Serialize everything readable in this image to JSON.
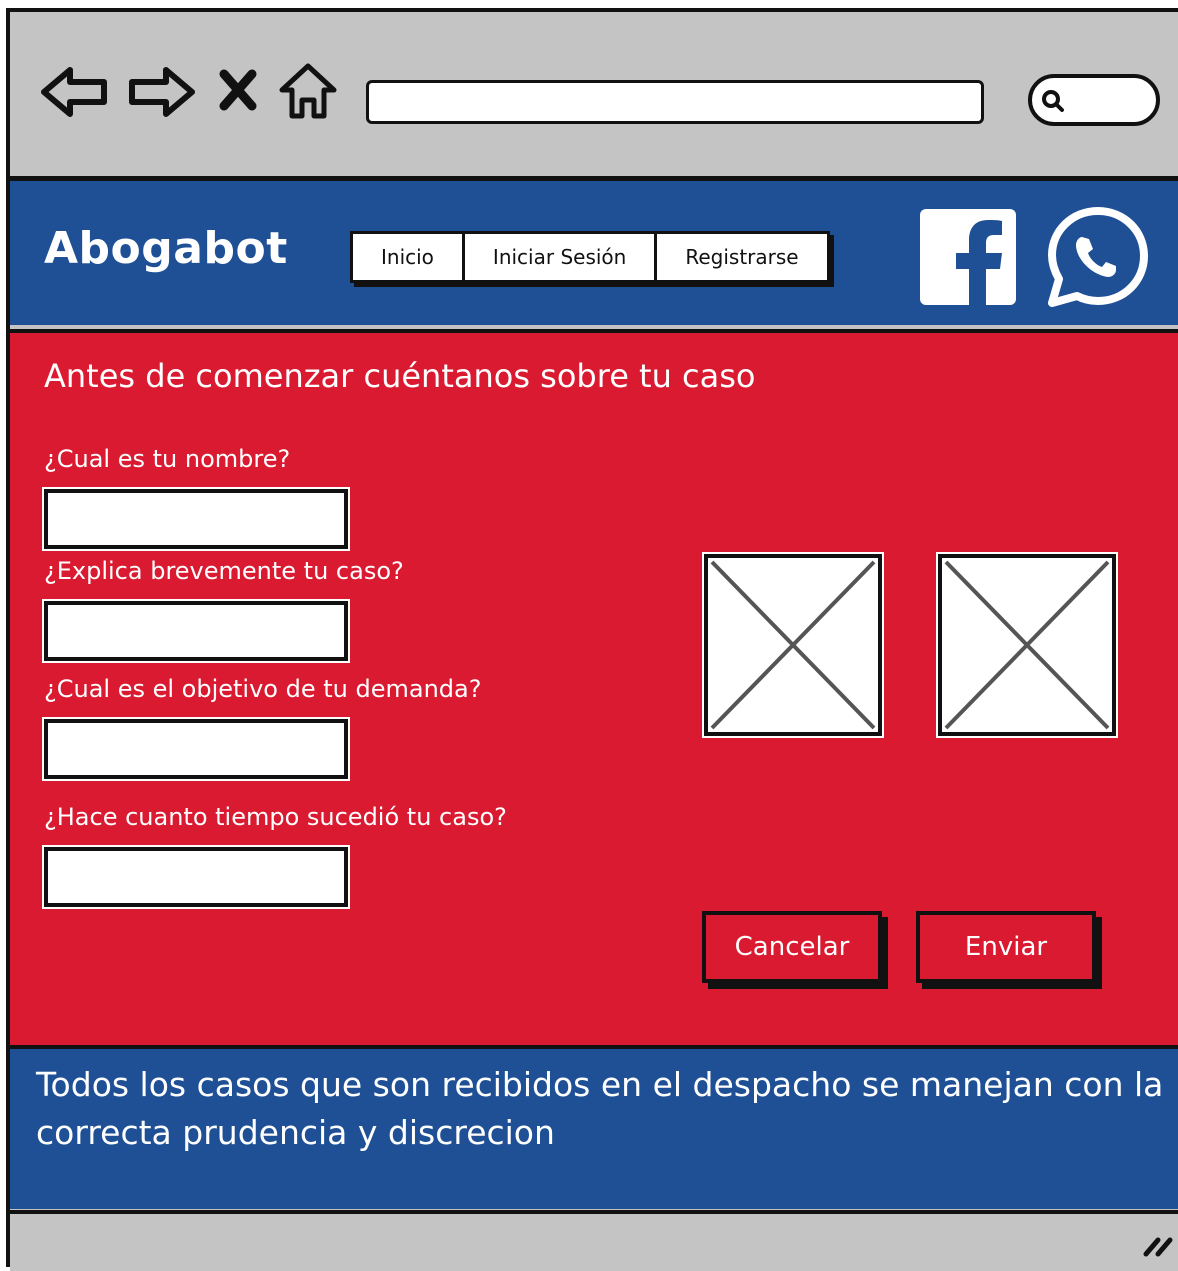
{
  "app": {
    "brand": "Abogabot"
  },
  "header": {
    "menu": [
      {
        "label": "Inicio"
      },
      {
        "label": "Iniciar Sesión"
      },
      {
        "label": "Registrarse"
      }
    ],
    "social_icons": [
      "facebook-icon",
      "whatsapp-icon"
    ]
  },
  "form": {
    "title": "Antes de comenzar cuéntanos sobre tu caso",
    "questions": [
      {
        "label": "¿Cual es tu nombre?",
        "value": ""
      },
      {
        "label": "¿Explica brevemente tu caso?",
        "value": ""
      },
      {
        "label": "¿Cual es el objetivo de tu demanda?",
        "value": ""
      },
      {
        "label": "¿Hace cuanto tiempo sucedió tu caso?",
        "value": ""
      }
    ],
    "buttons": {
      "cancel": "Cancelar",
      "submit": "Enviar"
    }
  },
  "footer": {
    "text": "Todos los casos que son recibidos en el despacho se manejan con la correcta prudencia y discrecion"
  },
  "colors": {
    "header_blue": "#1f5096",
    "main_red": "#da1a30",
    "chrome_gray": "#c4c4c4"
  }
}
